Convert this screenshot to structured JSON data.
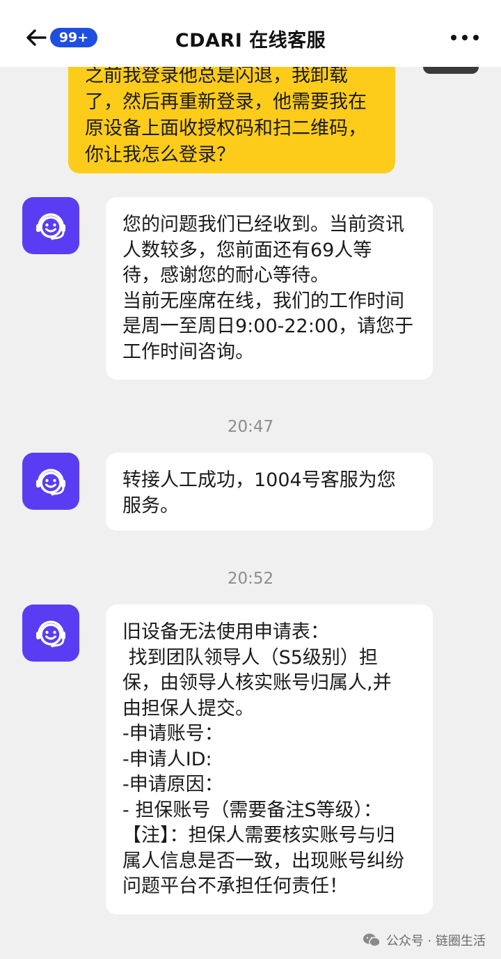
{
  "header": {
    "badge": "99+",
    "title": "CDARI 在线客服",
    "back_icon": "arrow-left-icon",
    "more_icon": "more-dots-icon"
  },
  "messages": {
    "user_partial": {
      "lines": "之前我登录他总是闪退，我卸载\n了，然后再重新登录，他需要我在\n原设备上面收授权码和扫二维码，\n你让我怎么登录？"
    },
    "agent_1": {
      "text": "您的问题我们已经收到。当前资讯\n人数较多，您前面还有69人等\n待，感谢您的耐心等待。\n当前无座席在线，我们的工作时间\n是周一至周日9:00-22:00，请您于\n工作时间咨询。"
    },
    "time_1": "20:47",
    "agent_2": {
      "text": "转接人工成功，1004号客服为您\n服务。"
    },
    "time_2": "20:52",
    "agent_3": {
      "text": "旧设备无法使用申请表：\n 找到团队领导人（S5级别）担\n保，由领导人核实账号归属人,并\n由担保人提交。\n-申请账号：\n-申请人ID:\n-申请原因：\n- 担保账号（需要备注S等级）：\n【注】：担保人需要核实账号与归\n属人信息是否一致，出现账号纠纷\n问题平台不承担任何责任！"
    }
  },
  "watermark": {
    "text": "公众号 · 链圈生活",
    "icon": "wechat-icon"
  },
  "colors": {
    "accent": "#1f4fe0",
    "user_bubble": "#fdcc1a",
    "agent_avatar": "#5a3df2",
    "background": "#f0f0f0"
  }
}
